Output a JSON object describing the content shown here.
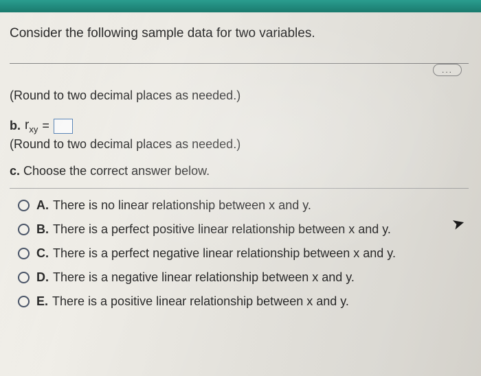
{
  "prompt": "Consider the following sample data for two variables.",
  "more": "...",
  "section_a": {
    "hint": "(Round to two decimal places as needed.)"
  },
  "section_b": {
    "label": "b.",
    "variable_html": "r",
    "sub": "xy",
    "equals": "=",
    "hint": "(Round to two decimal places as needed.)"
  },
  "section_c": {
    "label": "c.",
    "text": "Choose the correct answer below."
  },
  "options": [
    {
      "letter": "A.",
      "text": "There is no linear relationship between x and y."
    },
    {
      "letter": "B.",
      "text": "There is a perfect positive linear relationship between x and y."
    },
    {
      "letter": "C.",
      "text": "There is a perfect negative linear relationship between x and y."
    },
    {
      "letter": "D.",
      "text": "There is a negative linear relationship between x and y."
    },
    {
      "letter": "E.",
      "text": "There is a positive linear relationship between x and y."
    }
  ]
}
